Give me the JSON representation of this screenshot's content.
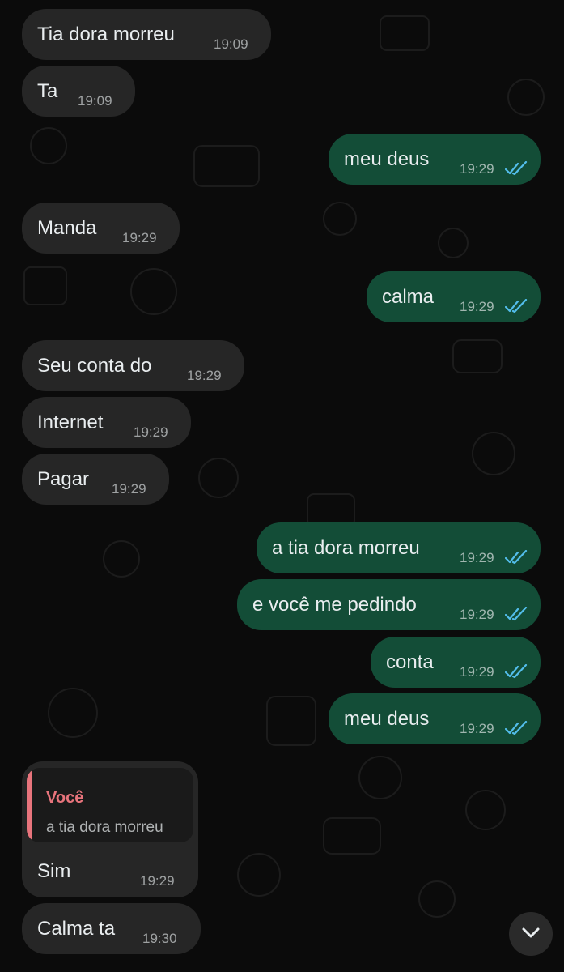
{
  "colors": {
    "background": "#0b0b0b",
    "incoming_bubble": "#262626",
    "outgoing_bubble": "#134d37",
    "text": "#e9edef",
    "read_ticks": "#53bdeb",
    "quote_accent": "#e8747c"
  },
  "messages": [
    {
      "direction": "in",
      "text": "Tia dora morreu",
      "time": "19:09"
    },
    {
      "direction": "in",
      "text": "Ta",
      "time": "19:09"
    },
    {
      "direction": "out",
      "text": "meu deus",
      "time": "19:29",
      "status": "read"
    },
    {
      "direction": "in",
      "text": "Manda",
      "time": "19:29"
    },
    {
      "direction": "out",
      "text": "calma",
      "time": "19:29",
      "status": "read"
    },
    {
      "direction": "in",
      "text": "Seu conta do",
      "time": "19:29"
    },
    {
      "direction": "in",
      "text": "Internet",
      "time": "19:29"
    },
    {
      "direction": "in",
      "text": "Pagar",
      "time": "19:29"
    },
    {
      "direction": "out",
      "text": "a tia dora morreu",
      "time": "19:29",
      "status": "read"
    },
    {
      "direction": "out",
      "text": "e você me pedindo",
      "time": "19:29",
      "status": "read"
    },
    {
      "direction": "out",
      "text": "conta",
      "time": "19:29",
      "status": "read"
    },
    {
      "direction": "out",
      "text": "meu deus",
      "time": "19:29",
      "status": "read"
    },
    {
      "direction": "in",
      "text": "Sim",
      "time": "19:29",
      "quote": {
        "author": "Você",
        "text": "a tia dora morreu"
      }
    },
    {
      "direction": "in",
      "text": "Calma ta",
      "time": "19:30"
    }
  ],
  "scroll_button": {
    "icon": "chevron-down-icon"
  }
}
